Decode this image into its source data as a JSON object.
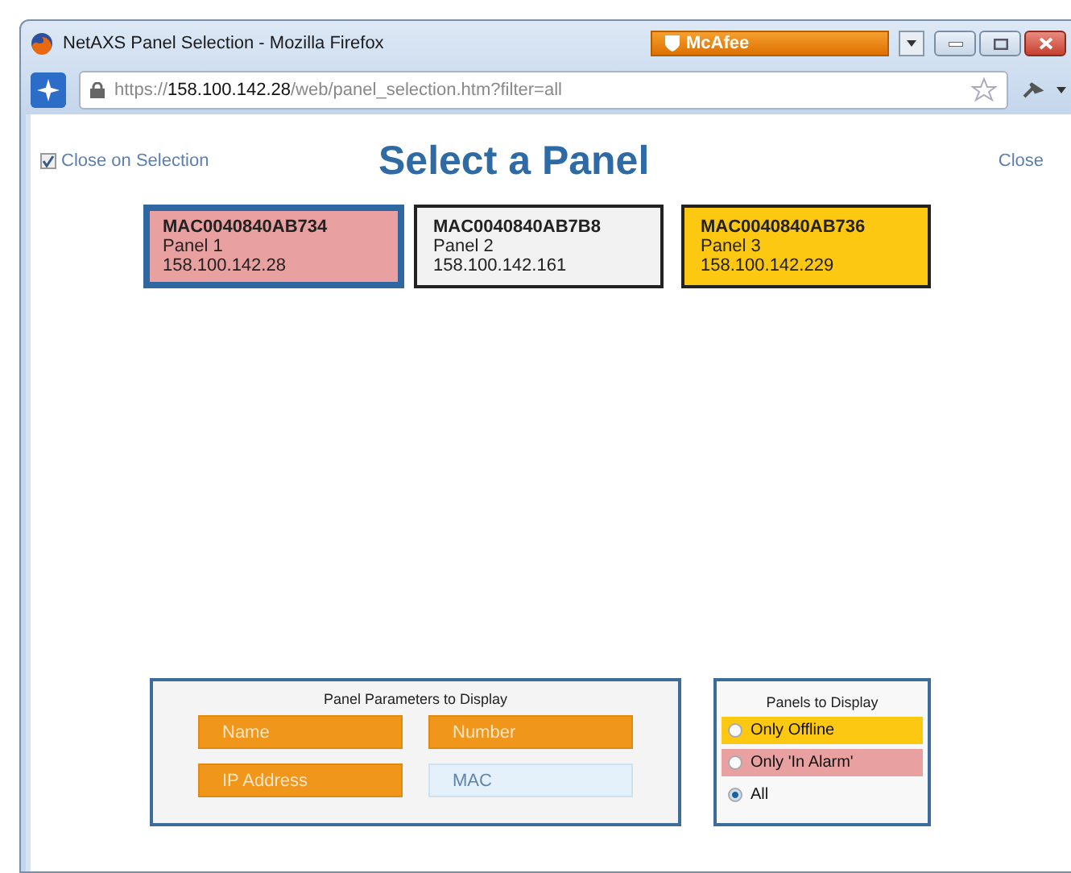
{
  "window": {
    "title": "NetAXS Panel Selection - Mozilla Firefox",
    "addon": "McAfee"
  },
  "address_bar": {
    "scheme": "https://",
    "host": "158.100.142.28",
    "path": "/web/panel_selection.htm?filter=all"
  },
  "close_on_selection": {
    "label": "Close on Selection",
    "checked": true
  },
  "heading": "Select a Panel",
  "close_link": "Close",
  "panels": [
    {
      "mac": "MAC0040840AB734",
      "name": "Panel 1",
      "ip": "158.100.142.28",
      "color": "#e8a0a0",
      "selected": true
    },
    {
      "mac": "MAC0040840AB7B8",
      "name": "Panel 2",
      "ip": "158.100.142.161",
      "color": "#f2f2f2",
      "selected": false
    },
    {
      "mac": "MAC0040840AB736",
      "name": "Panel 3",
      "ip": "158.100.142.229",
      "color": "#fcc812",
      "selected": false
    }
  ],
  "parameters": {
    "title": "Panel Parameters to Display",
    "items": [
      {
        "label": "Name",
        "on": true
      },
      {
        "label": "Number",
        "on": true
      },
      {
        "label": "IP Address",
        "on": true
      },
      {
        "label": "MAC",
        "on": false
      }
    ]
  },
  "filter": {
    "title": "Panels to Display",
    "options": [
      {
        "label": "Only Offline",
        "color": "#fcc812",
        "selected": false
      },
      {
        "label": "Only 'In Alarm'",
        "color": "#e8a0a0",
        "selected": false
      },
      {
        "label": "All",
        "selected": true
      }
    ]
  }
}
